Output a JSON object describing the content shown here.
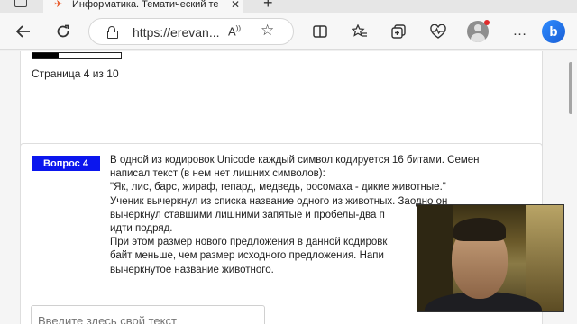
{
  "browser": {
    "tab": {
      "title": "Информатика. Тематический те",
      "favicon": "airplane-icon"
    },
    "address_bar": {
      "url": "https://erevan...",
      "lock_icon": "lock-icon"
    },
    "toolbar_icons": [
      "back-arrow-icon",
      "refresh-icon",
      "read-aloud-icon",
      "favorite-star-icon",
      "split-screen-icon",
      "favorites-icon",
      "collections-icon",
      "heart-monitor-icon",
      "profile-avatar-icon",
      "bing-copilot-icon"
    ]
  },
  "quiz_nav": {
    "page_label": "Страница 4 из 10",
    "progress_fraction": 0.3
  },
  "question": {
    "badge": "Вопрос 4",
    "lines": [
      "В одной из кодировок Unicode каждый символ кодируется 16 битами. Семен",
      "написал текст (в нем нет лишних символов):",
      "\"Як, лис, барс, жираф, гепард, медведь, росомаха - дикие животные.\"",
      "Ученик вычеркнул из списка название одного из животных. Заодно он",
      "вычеркнул ставшими лишними запятые и пробелы-два п",
      "идти подряд.",
      "При этом размер нового предложения в данной кодировк",
      "байт меньше, чем размер исходного предложения. Напи",
      "вычеркнутое название животного."
    ]
  },
  "answer_field": {
    "placeholder": "Введите здесь свой текст"
  },
  "colors": {
    "badge_bg": "#0b16ee",
    "badge_text": "#ffffff",
    "progress_fill": "#000000"
  }
}
